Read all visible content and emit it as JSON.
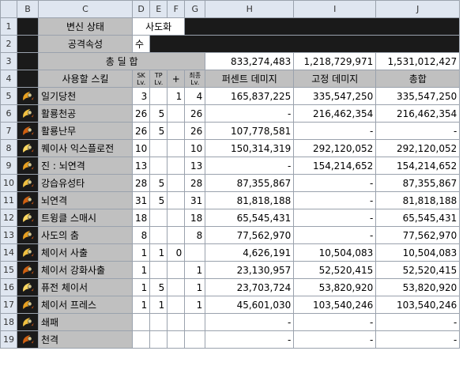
{
  "column_headers": [
    "B",
    "C",
    "D",
    "E",
    "F",
    "G",
    "H",
    "I",
    "J"
  ],
  "rows_top": {
    "r1": {
      "label": "변신 상태",
      "value": "사도화"
    },
    "r2": {
      "label": "공격속성",
      "value": "수"
    },
    "r3": {
      "label": "총 딜 합",
      "h": "833,274,483",
      "i": "1,218,729,971",
      "j": "1,531,012,427"
    },
    "r4": {
      "c": "사용할 스킬",
      "d": "SK Lv.",
      "e": "TP Lv.",
      "f": "+",
      "g": "최종 Lv.",
      "h": "퍼센트 데미지",
      "i": "고정 데미지",
      "j": "총합"
    }
  },
  "skills": [
    {
      "row": "5",
      "name": "일기당천",
      "sk": "3",
      "tp": "",
      "plus": "1",
      "final": "4",
      "pct": "165,837,225",
      "fixed": "335,547,250",
      "total": "335,547,250",
      "icon": "fire-swirl-icon"
    },
    {
      "row": "6",
      "name": "활룡천공",
      "sk": "26",
      "tp": "5",
      "plus": "",
      "final": "26",
      "pct": "-",
      "fixed": "216,462,354",
      "total": "216,462,354",
      "icon": "dragon-icon"
    },
    {
      "row": "7",
      "name": "활룡난무",
      "sk": "26",
      "tp": "5",
      "plus": "",
      "final": "26",
      "pct": "107,778,581",
      "fixed": "-",
      "total": "-",
      "icon": "dragon-dance-icon"
    },
    {
      "row": "8",
      "name": "퀘이사 익스플로전",
      "sk": "10",
      "tp": "",
      "plus": "",
      "final": "10",
      "pct": "150,314,319",
      "fixed": "292,120,052",
      "total": "292,120,052",
      "icon": "explosion-icon"
    },
    {
      "row": "9",
      "name": "진 : 뇌연격",
      "sk": "13",
      "tp": "",
      "plus": "",
      "final": "13",
      "pct": "-",
      "fixed": "154,214,652",
      "total": "154,214,652",
      "icon": "thunder-icon"
    },
    {
      "row": "10",
      "name": "강습유성타",
      "sk": "28",
      "tp": "5",
      "plus": "",
      "final": "28",
      "pct": "87,355,867",
      "fixed": "-",
      "total": "87,355,867",
      "icon": "meteor-icon"
    },
    {
      "row": "11",
      "name": "뇌연격",
      "sk": "31",
      "tp": "5",
      "plus": "",
      "final": "31",
      "pct": "81,818,188",
      "fixed": "-",
      "total": "81,818,188",
      "icon": "lightning-icon"
    },
    {
      "row": "12",
      "name": "트윙클 스매시",
      "sk": "18",
      "tp": "",
      "plus": "",
      "final": "18",
      "pct": "65,545,431",
      "fixed": "-",
      "total": "65,545,431",
      "icon": "twinkle-icon"
    },
    {
      "row": "13",
      "name": "사도의 춤",
      "sk": "8",
      "tp": "",
      "plus": "",
      "final": "8",
      "pct": "77,562,970",
      "fixed": "-",
      "total": "77,562,970",
      "icon": "dance-icon"
    },
    {
      "row": "14",
      "name": "체이서 사출",
      "sk": "1",
      "tp": "1",
      "plus": "0",
      "final": "",
      "pct": "4,626,191",
      "fixed": "10,504,083",
      "total": "10,504,083",
      "icon": "chaser-icon"
    },
    {
      "row": "15",
      "name": "체이서 강화사출",
      "sk": "1",
      "tp": "",
      "plus": "",
      "final": "1",
      "pct": "23,130,957",
      "fixed": "52,520,415",
      "total": "52,520,415",
      "icon": "chaser-strong-icon"
    },
    {
      "row": "16",
      "name": "퓨전 체이서",
      "sk": "1",
      "tp": "5",
      "plus": "",
      "final": "1",
      "pct": "23,703,724",
      "fixed": "53,820,920",
      "total": "53,820,920",
      "icon": "fusion-icon"
    },
    {
      "row": "17",
      "name": "체이서 프레스",
      "sk": "1",
      "tp": "1",
      "plus": "",
      "final": "1",
      "pct": "45,601,030",
      "fixed": "103,540,246",
      "total": "103,540,246",
      "icon": "press-icon"
    },
    {
      "row": "18",
      "name": "쇄패",
      "sk": "",
      "tp": "",
      "plus": "",
      "final": "",
      "pct": "-",
      "fixed": "-",
      "total": "-",
      "icon": "shatter-icon"
    },
    {
      "row": "19",
      "name": "천격",
      "sk": "",
      "tp": "",
      "plus": "",
      "final": "",
      "pct": "-",
      "fixed": "-",
      "total": "-",
      "icon": "heaven-strike-icon"
    }
  ]
}
